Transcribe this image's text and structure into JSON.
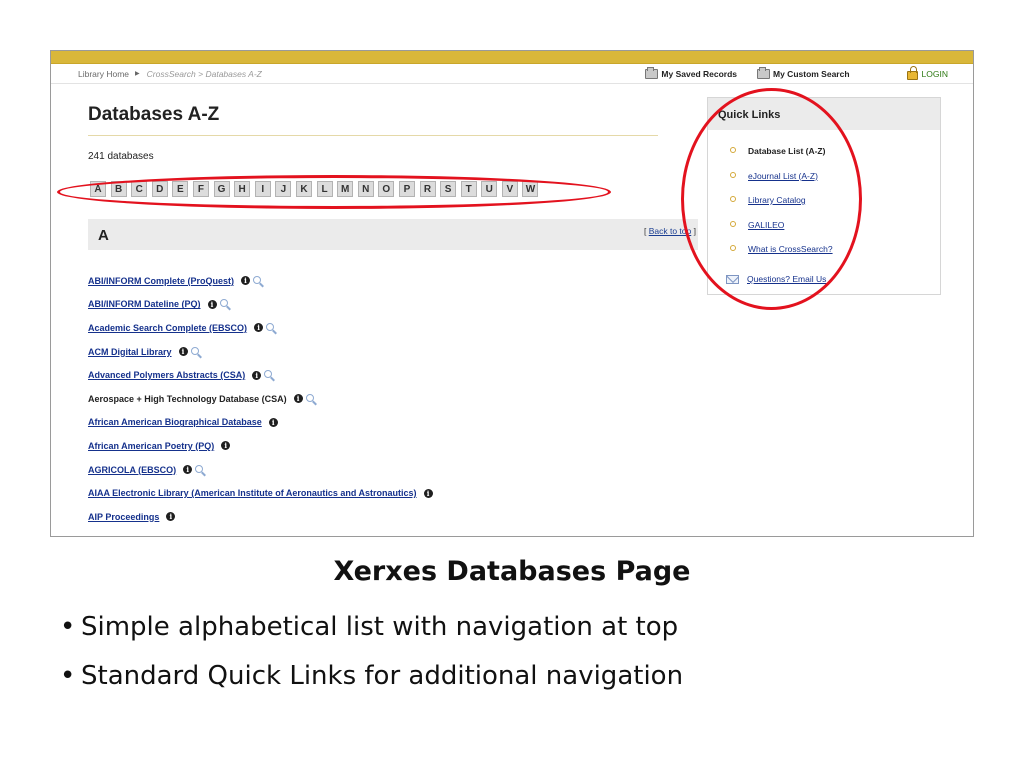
{
  "slide": {
    "title": "Xerxes Databases Page",
    "bullets": [
      "Simple alphabetical list with navigation at top",
      "Standard Quick Links for additional navigation"
    ]
  },
  "navbar": {
    "home": "Library Home",
    "path": "CrossSearch > Databases A-Z",
    "saved_records": "My Saved Records",
    "custom_search": "My Custom Search",
    "login": "LOGIN"
  },
  "main": {
    "title": "Databases A-Z",
    "count": "241 databases",
    "letters": [
      "A",
      "B",
      "C",
      "D",
      "E",
      "F",
      "G",
      "H",
      "I",
      "J",
      "K",
      "L",
      "M",
      "N",
      "O",
      "P",
      "R",
      "S",
      "T",
      "U",
      "V",
      "W"
    ],
    "section_letter": "A",
    "back_to_top_open": "[",
    "back_to_top": "Back to top",
    "back_to_top_close": "]",
    "databases": [
      {
        "name": "ABI/INFORM Complete (ProQuest)",
        "info": true,
        "search": true,
        "linked": true
      },
      {
        "name": "ABI/INFORM Dateline (PQ)",
        "info": true,
        "search": true,
        "linked": true
      },
      {
        "name": "Academic Search Complete (EBSCO)",
        "info": true,
        "search": true,
        "linked": true
      },
      {
        "name": "ACM Digital Library",
        "info": true,
        "search": true,
        "linked": true
      },
      {
        "name": "Advanced Polymers Abstracts (CSA)",
        "info": true,
        "search": true,
        "linked": true
      },
      {
        "name": "Aerospace + High Technology Database (CSA)",
        "info": true,
        "search": true,
        "linked": false
      },
      {
        "name": "African American Biographical Database",
        "info": true,
        "search": false,
        "linked": true
      },
      {
        "name": "African American Poetry (PQ)",
        "info": true,
        "search": false,
        "linked": true
      },
      {
        "name": "AGRICOLA (EBSCO)",
        "info": true,
        "search": true,
        "linked": true
      },
      {
        "name": "AIAA Electronic Library (American Institute of Aeronautics and Astronautics)",
        "info": true,
        "search": false,
        "linked": true
      },
      {
        "name": "AIP Proceedings",
        "info": true,
        "search": false,
        "linked": true
      }
    ]
  },
  "quick_links": {
    "title": "Quick Links",
    "items": [
      {
        "label": "Database List (A-Z)",
        "current": true
      },
      {
        "label": "eJournal List (A-Z)",
        "current": false
      },
      {
        "label": "Library Catalog",
        "current": false
      },
      {
        "label": "GALILEO",
        "current": false
      },
      {
        "label": "What is CrossSearch?",
        "current": false
      }
    ],
    "email": "Questions? Email Us"
  },
  "annotation_color": "#e3121e",
  "accent_color": "#d9b73a"
}
